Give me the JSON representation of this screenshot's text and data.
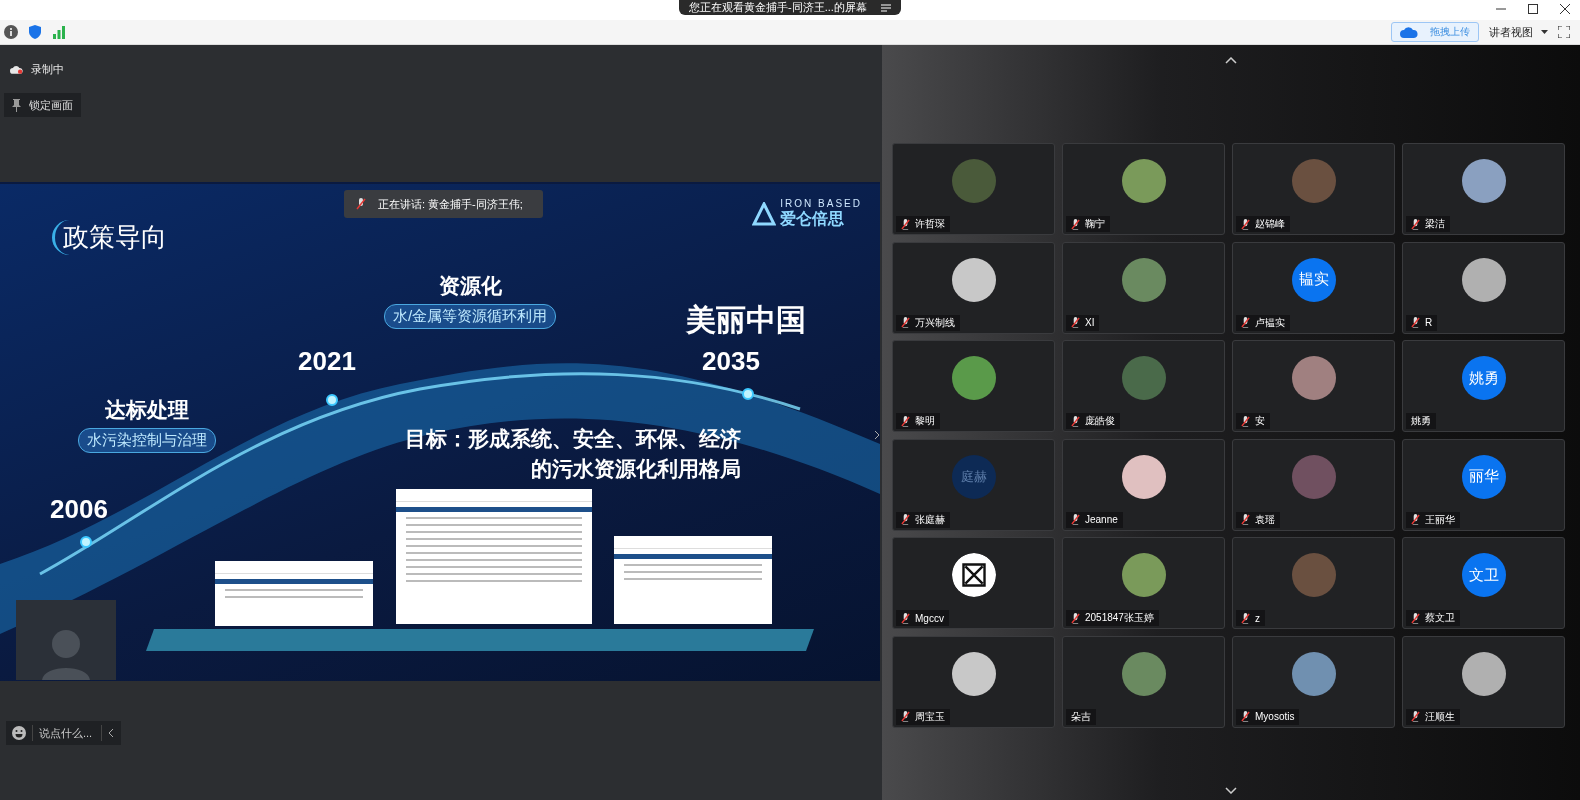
{
  "title_bar": {
    "title": "您正在观看黄金捕手-同济王...的屏幕"
  },
  "toolbar": {
    "upload_button": "拖拽上传",
    "view_mode": "讲者视图"
  },
  "recording": {
    "label": "录制中"
  },
  "lock_screen": {
    "label": "锁定画面"
  },
  "slide": {
    "heading": "政策导向",
    "logo_en": "IRON BASED",
    "logo_cn": "爱仑倍思",
    "speaker": "正在讲话: 黄金捕手-同济王伟;",
    "milestones": [
      {
        "year": "2006",
        "title": "达标处理",
        "tag": "水污染控制与治理"
      },
      {
        "year": "2021",
        "title": "资源化",
        "tag": "水/金属等资源循环利用"
      },
      {
        "year": "2035",
        "title": "美丽中国"
      }
    ],
    "goal_lines": [
      "目标：形成系统、安全、环保、经济",
      "的污水资源化利用格局"
    ]
  },
  "chat": {
    "placeholder": "说点什么..."
  },
  "participants": [
    {
      "name": "许哲琛",
      "muted": true,
      "kind": "photo"
    },
    {
      "name": "鞠宁",
      "muted": true,
      "kind": "photo"
    },
    {
      "name": "赵锦峰",
      "muted": true,
      "kind": "photo"
    },
    {
      "name": "梁洁",
      "muted": true,
      "kind": "photo"
    },
    {
      "name": "万兴制线",
      "muted": true,
      "kind": "photo"
    },
    {
      "name": "XI",
      "muted": true,
      "kind": "photo"
    },
    {
      "name": "卢韫实",
      "muted": true,
      "kind": "initials",
      "initials": "韫实"
    },
    {
      "name": "R",
      "muted": true,
      "kind": "photo"
    },
    {
      "name": "黎明",
      "muted": true,
      "kind": "photo"
    },
    {
      "name": "庞皓俊",
      "muted": true,
      "kind": "photo"
    },
    {
      "name": "安",
      "muted": true,
      "kind": "photo"
    },
    {
      "name": "姚勇",
      "muted": false,
      "kind": "initials",
      "initials": "姚勇"
    },
    {
      "name": "张庭赫",
      "muted": true,
      "kind": "phone",
      "initials": "庭赫"
    },
    {
      "name": "Jeanne",
      "muted": true,
      "kind": "photo"
    },
    {
      "name": "袁瑶",
      "muted": true,
      "kind": "photo"
    },
    {
      "name": "王丽华",
      "muted": true,
      "kind": "initials",
      "initials": "丽华"
    },
    {
      "name": "Mgccv",
      "muted": true,
      "kind": "logo"
    },
    {
      "name": "2051847张玉婷",
      "muted": true,
      "kind": "photo"
    },
    {
      "name": "z",
      "muted": true,
      "kind": "photo"
    },
    {
      "name": "蔡文卫",
      "muted": true,
      "kind": "initials",
      "initials": "文卫"
    },
    {
      "name": "周宝玉",
      "muted": true,
      "kind": "photo"
    },
    {
      "name": "朵吉",
      "muted": false,
      "kind": "photo"
    },
    {
      "name": "Myosotis",
      "muted": true,
      "kind": "photo"
    },
    {
      "name": "汪顺生",
      "muted": true,
      "kind": "photo"
    }
  ]
}
